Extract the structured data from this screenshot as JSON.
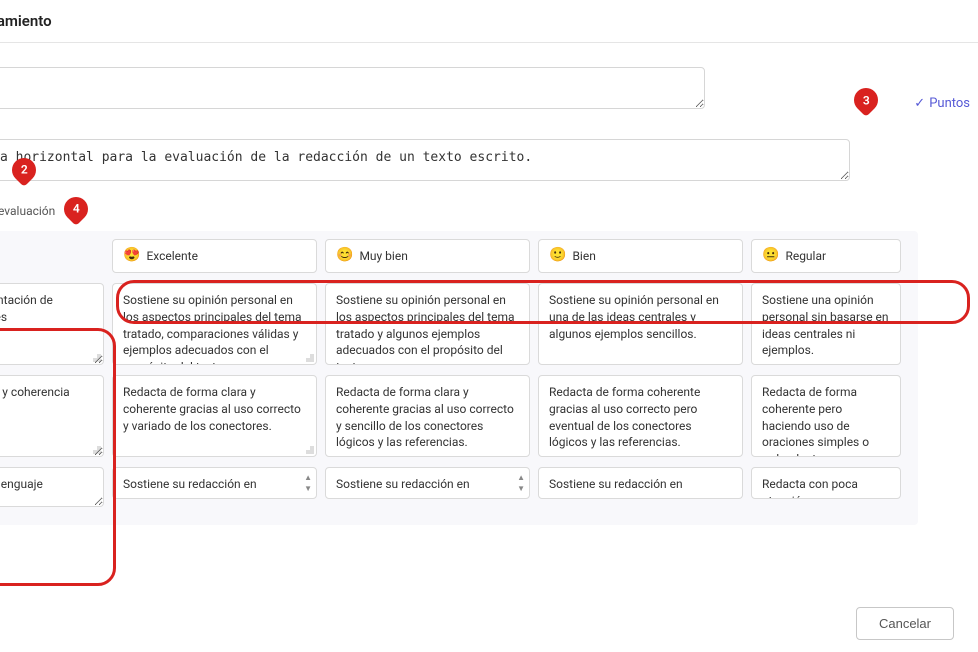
{
  "header": {
    "title": "Encabezamiento"
  },
  "puntos": {
    "label": "Puntos"
  },
  "title_field": {
    "value": ""
  },
  "description_field": {
    "value": "Rúbrica horizontal para la evaluación de la redacción de un texto escrito."
  },
  "section": {
    "label": "Criterio de evaluación"
  },
  "annotations": {
    "a2": "2",
    "a3": "3",
    "a4": "4"
  },
  "levels": [
    {
      "emoji": "😍",
      "label": "Excelente"
    },
    {
      "emoji": "😊",
      "label": "Muy bien"
    },
    {
      "emoji": "🙂",
      "label": "Bien"
    },
    {
      "emoji": "😐",
      "label": "Regular"
    }
  ],
  "criteria": [
    {
      "name": "Argumentación de opiniones",
      "cells": [
        "Sostiene su opinión personal en los aspectos principales del tema tratado, comparaciones válidas y ejemplos adecuados con el propósito del texto.",
        "Sostiene su opinión personal en los aspectos principales del tema tratado y algunos ejemplos adecuados con el propósito del texto.",
        "Sostiene su opinión personal en una de las ideas centrales y algunos ejemplos sencillos.",
        "Sostiene una opinión personal sin basarse en ideas centrales ni ejemplos."
      ]
    },
    {
      "name": "Claridad y coherencia",
      "cells": [
        "Redacta de forma clara y coherente gracias al uso correcto y variado de los conectores.",
        "Redacta de forma clara y coherente gracias al uso correcto y sencillo de los conectores lógicos y las referencias.",
        "Redacta de forma coherente gracias al uso correcto pero eventual de los conectores lógicos y las referencias.",
        "Redacta de forma coherente pero haciendo uso de oraciones simples o redundantes."
      ]
    },
    {
      "name": "Uso del lenguaje",
      "cells": [
        "Sostiene su redacción en",
        "Sostiene su redacción en",
        "Sostiene su redacción en",
        "Redacta con poca atención"
      ]
    }
  ],
  "footer": {
    "cancel": "Cancelar"
  }
}
